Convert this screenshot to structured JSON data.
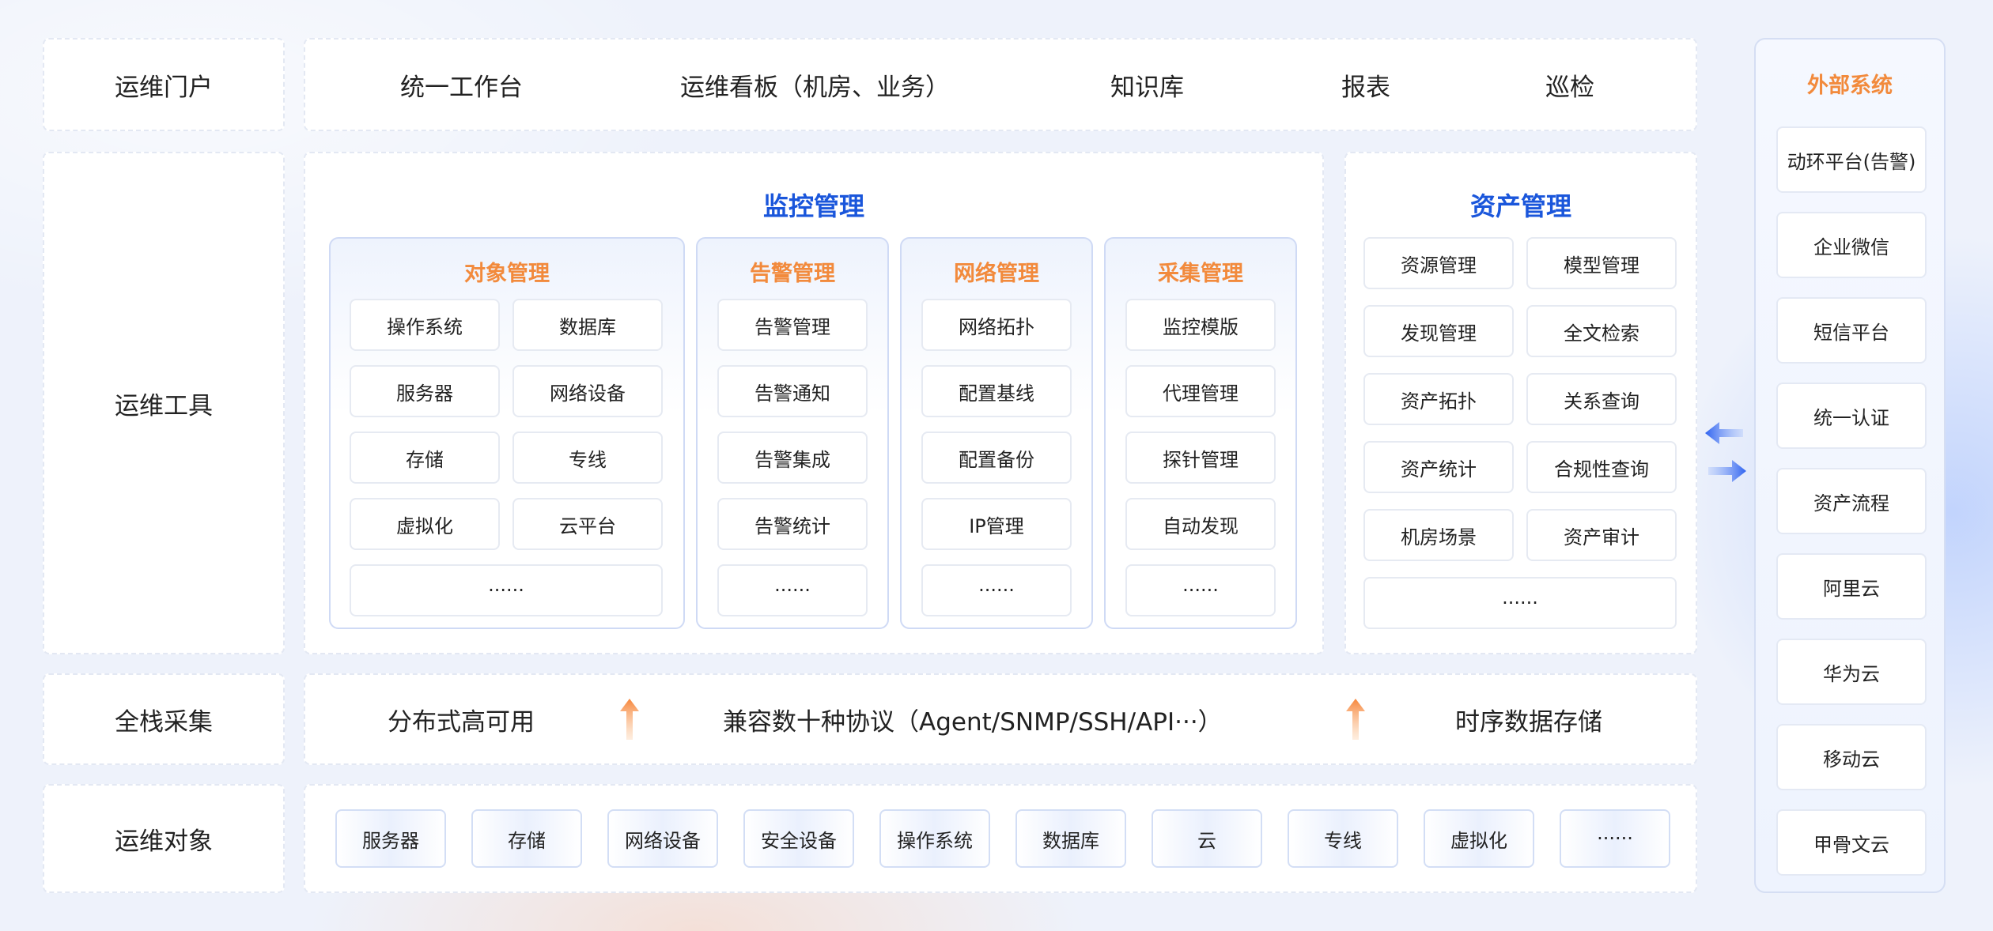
{
  "rows": {
    "portal_label": "运维门户",
    "tools_label": "运维工具",
    "collect_label": "全栈采集",
    "objects_label": "运维对象"
  },
  "portal_items": [
    "统一工作台",
    "运维看板（机房、业务）",
    "知识库",
    "报表",
    "巡检"
  ],
  "monitoring": {
    "title": "监控管理",
    "groups": [
      {
        "title": "对象管理",
        "items": [
          "操作系统",
          "数据库",
          "服务器",
          "网络设备",
          "存储",
          "专线",
          "虚拟化",
          "云平台",
          "······"
        ]
      },
      {
        "title": "告警管理",
        "items": [
          "告警管理",
          "告警通知",
          "告警集成",
          "告警统计",
          "······"
        ]
      },
      {
        "title": "网络管理",
        "items": [
          "网络拓扑",
          "配置基线",
          "配置备份",
          "IP管理",
          "······"
        ]
      },
      {
        "title": "采集管理",
        "items": [
          "监控模版",
          "代理管理",
          "探针管理",
          "自动发现",
          "······"
        ]
      }
    ]
  },
  "assets": {
    "title": "资产管理",
    "items": [
      "资源管理",
      "模型管理",
      "发现管理",
      "全文检索",
      "资产拓扑",
      "关系查询",
      "资产统计",
      "合规性查询",
      "机房场景",
      "资产审计",
      "······"
    ]
  },
  "collect_items": [
    "分布式高可用",
    "兼容数十种协议（Agent/SNMP/SSH/API···）",
    "时序数据存储"
  ],
  "objects": [
    "服务器",
    "存储",
    "网络设备",
    "安全设备",
    "操作系统",
    "数据库",
    "云",
    "专线",
    "虚拟化",
    "······"
  ],
  "external": {
    "title": "外部系统",
    "items": [
      "动环平台(告警)",
      "企业微信",
      "短信平台",
      "统一认证",
      "资产流程",
      "阿里云",
      "华为云",
      "移动云",
      "甲骨文云"
    ]
  },
  "colors": {
    "title_blue": "#1a56db",
    "accent_orange": "#f28a3c",
    "arrow_blue": "#3f74f5"
  }
}
